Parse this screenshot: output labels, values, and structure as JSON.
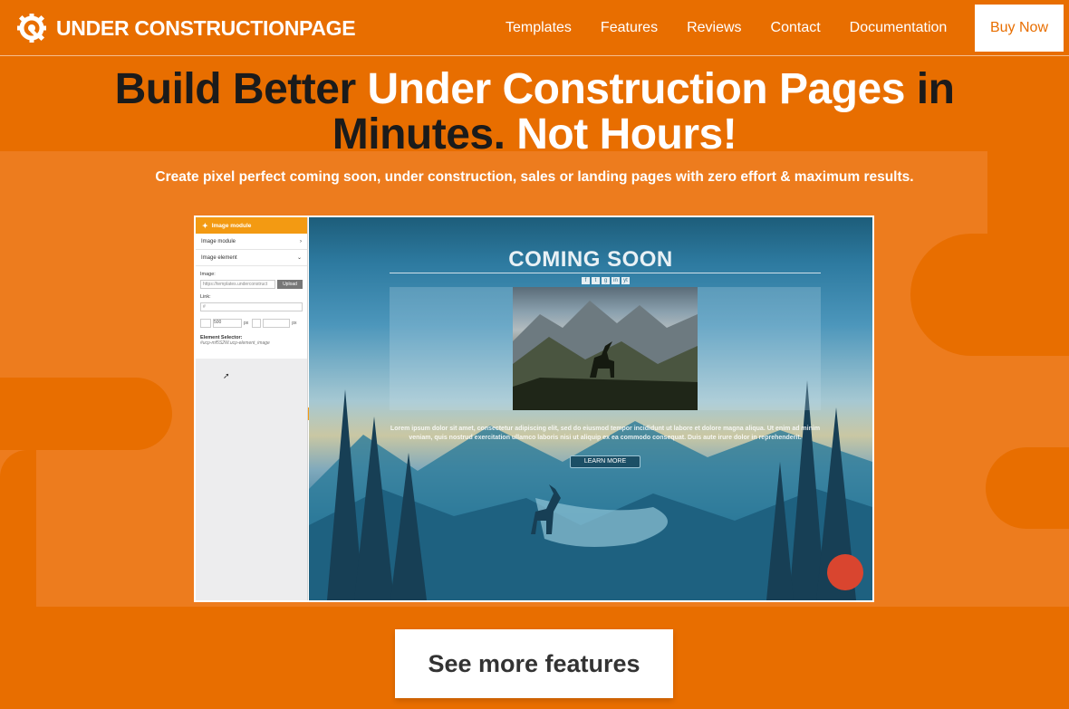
{
  "brand": {
    "logo_text": "UNDER CONSTRUCTIONPAGE",
    "accent_color": "#e86e00",
    "band_color": "#ed7c1e"
  },
  "nav": {
    "items": [
      "Templates",
      "Features",
      "Reviews",
      "Contact",
      "Documentation"
    ],
    "buy_label": "Buy Now"
  },
  "hero": {
    "headline_part1": "Build Better ",
    "headline_part2": "Under Construction Pages",
    "headline_part3": " in",
    "headline_part4": "Minutes.",
    "headline_part5": " Not Hours!",
    "subhead": "Create pixel perfect coming soon, under construction, sales or landing pages with zero effort & maximum results."
  },
  "screenshot": {
    "panel": {
      "header": "Image module",
      "rows": [
        "Image module",
        "Image element"
      ],
      "image_label": "Image:",
      "image_value": "https://templates.underconstruct",
      "upload_label": "Upload",
      "link_label": "Link:",
      "link_value": "#",
      "size_value": "500",
      "unit_px": "px",
      "selector_label": "Element Selector:",
      "selector_value": "#ucp-mf5S2W.ucp-element_image"
    },
    "preview": {
      "title": "COMING SOON",
      "social_icons": [
        "f",
        "t",
        "g",
        "in",
        "yt"
      ],
      "body_text": "Lorem ipsum dolor sit amet, consectetur adipiscing elit, sed do eiusmod tempor incididunt ut labore et dolore magna aliqua. Ut enim ad minim veniam, quis nostrud exercitation ullamco laboris nisi ut aliquip ex ea commodo consequat. Duis aute irure dolor in reprehenderit.",
      "button_label": "LEARN MORE"
    }
  },
  "cta": {
    "label": "See more features"
  }
}
